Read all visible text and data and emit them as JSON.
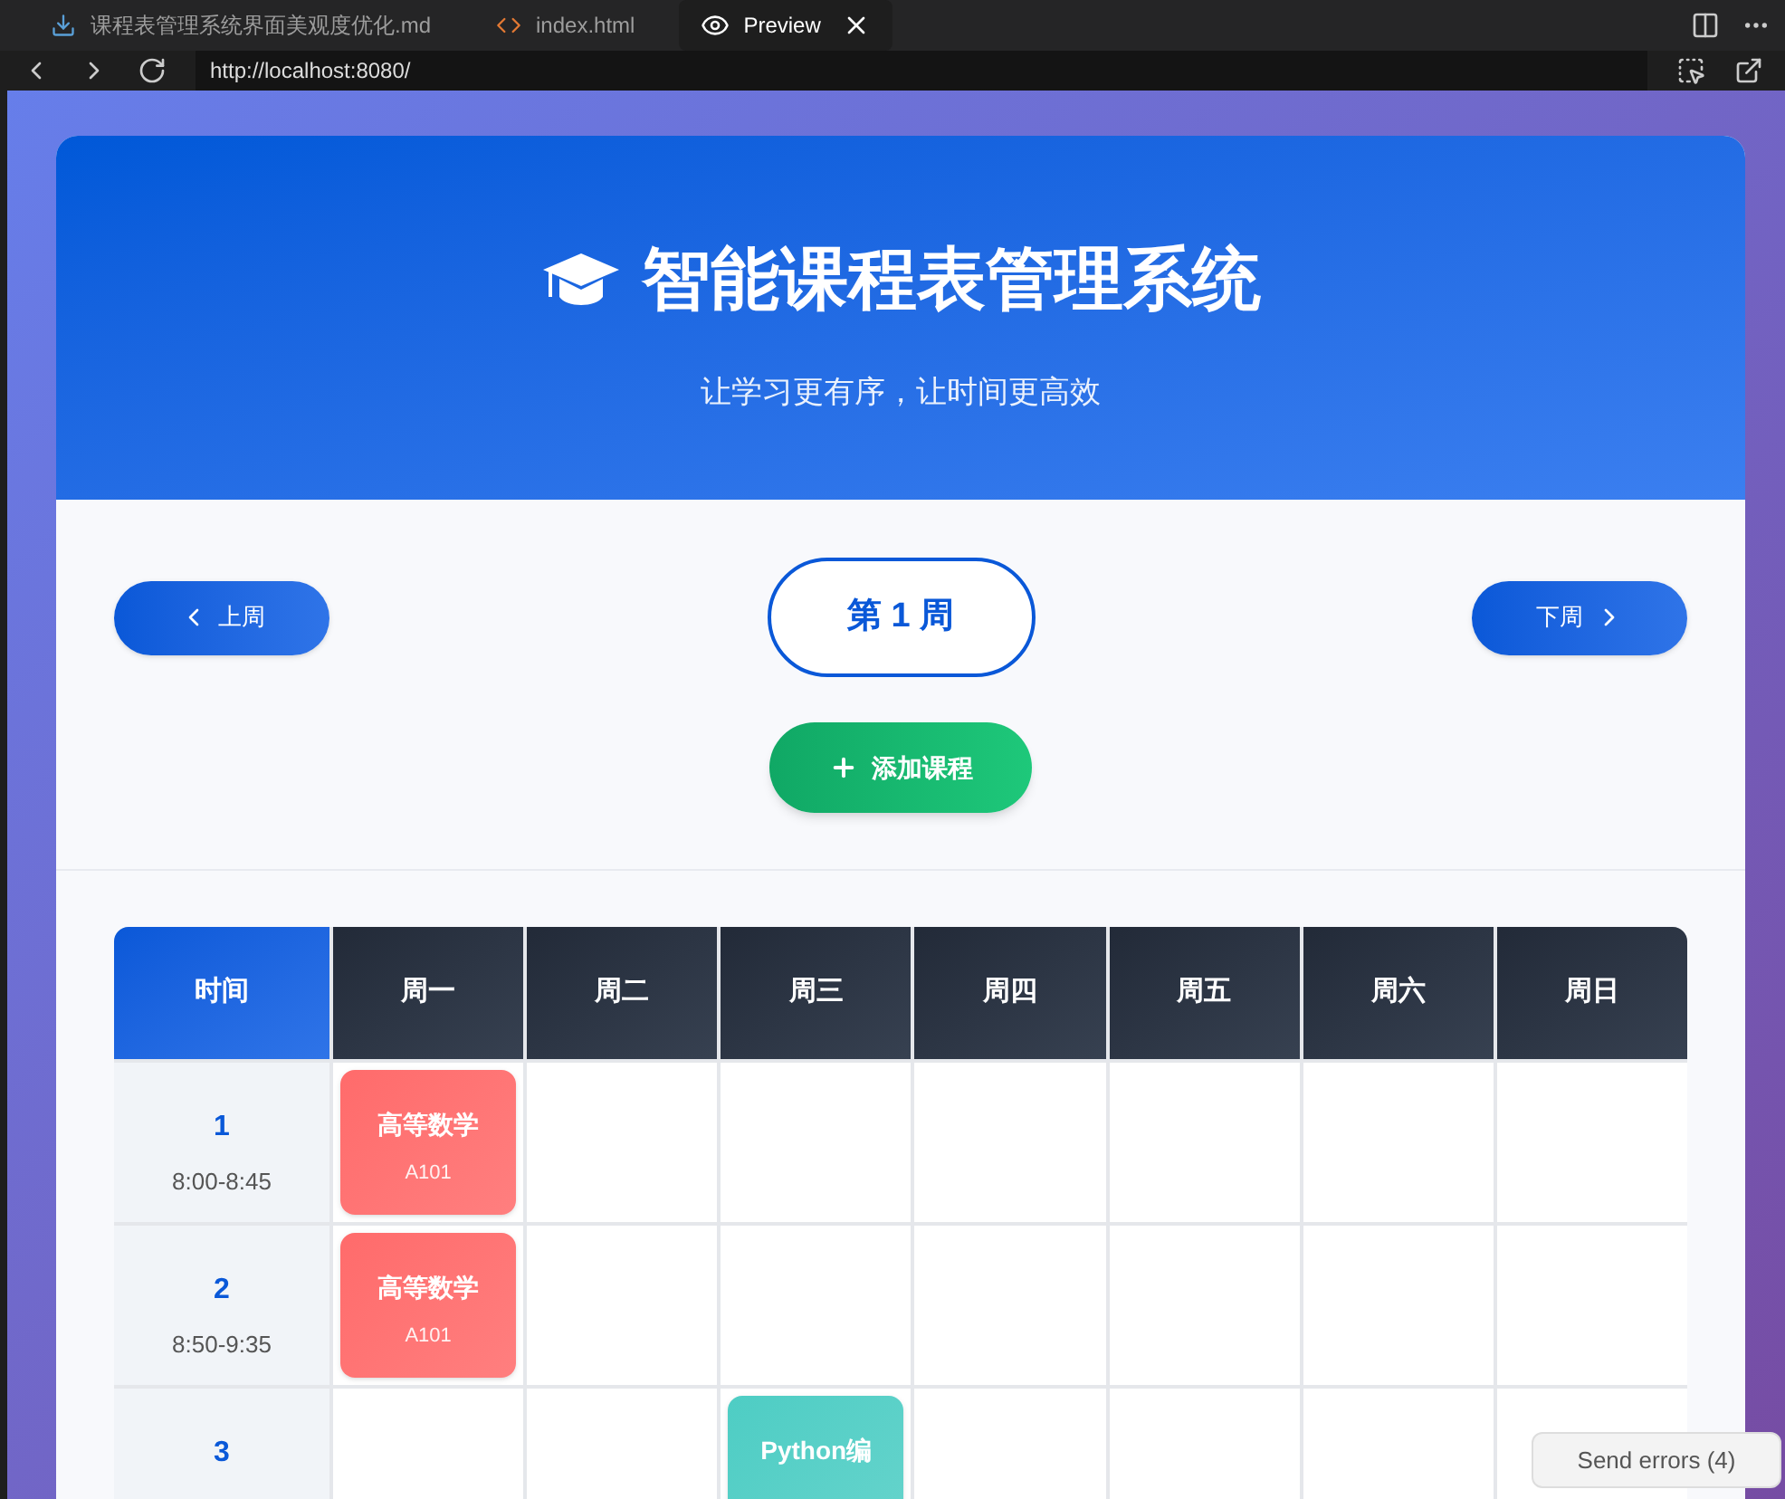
{
  "editor_tabs": [
    {
      "label": "课程表管理系统界面美观度优化.md",
      "kind": "markdown",
      "selected": false
    },
    {
      "label": "index.html",
      "kind": "html",
      "selected": false
    },
    {
      "label": "Preview",
      "kind": "preview",
      "selected": true
    }
  ],
  "address": "http://localhost:8080/",
  "header": {
    "title": "智能课程表管理系统",
    "subtitle": "让学习更有序，让时间更高效"
  },
  "week_nav": {
    "prev": "上周",
    "week": "第 1 周",
    "next": "下周"
  },
  "add_button": "添加课程",
  "table": {
    "columns": [
      "时间",
      "周一",
      "周二",
      "周三",
      "周四",
      "周五",
      "周六",
      "周日"
    ],
    "rows": [
      {
        "cells": [
          {
            "kind": "time",
            "period": "1",
            "time": "8:00-8:45"
          },
          {
            "kind": "course",
            "name": "高等数学",
            "room": "A101",
            "color": "#ff6b6b"
          },
          {
            "kind": "empty"
          },
          {
            "kind": "empty"
          },
          {
            "kind": "empty"
          },
          {
            "kind": "empty"
          },
          {
            "kind": "empty"
          },
          {
            "kind": "empty"
          }
        ]
      },
      {
        "cells": [
          {
            "kind": "time",
            "period": "2",
            "time": "8:50-9:35"
          },
          {
            "kind": "course",
            "name": "高等数学",
            "room": "A101",
            "color": "#ff6b6b"
          },
          {
            "kind": "empty"
          },
          {
            "kind": "empty"
          },
          {
            "kind": "empty"
          },
          {
            "kind": "empty"
          },
          {
            "kind": "empty"
          },
          {
            "kind": "empty"
          }
        ]
      },
      {
        "cells": [
          {
            "kind": "time",
            "period": "3"
          },
          {
            "kind": "empty"
          },
          {
            "kind": "empty"
          },
          {
            "kind": "course",
            "name": "Python编",
            "color": "#4ecdc4"
          },
          {
            "kind": "empty"
          },
          {
            "kind": "empty"
          },
          {
            "kind": "empty"
          },
          {
            "kind": "empty"
          }
        ]
      }
    ]
  },
  "error_button": "Send errors (4)"
}
